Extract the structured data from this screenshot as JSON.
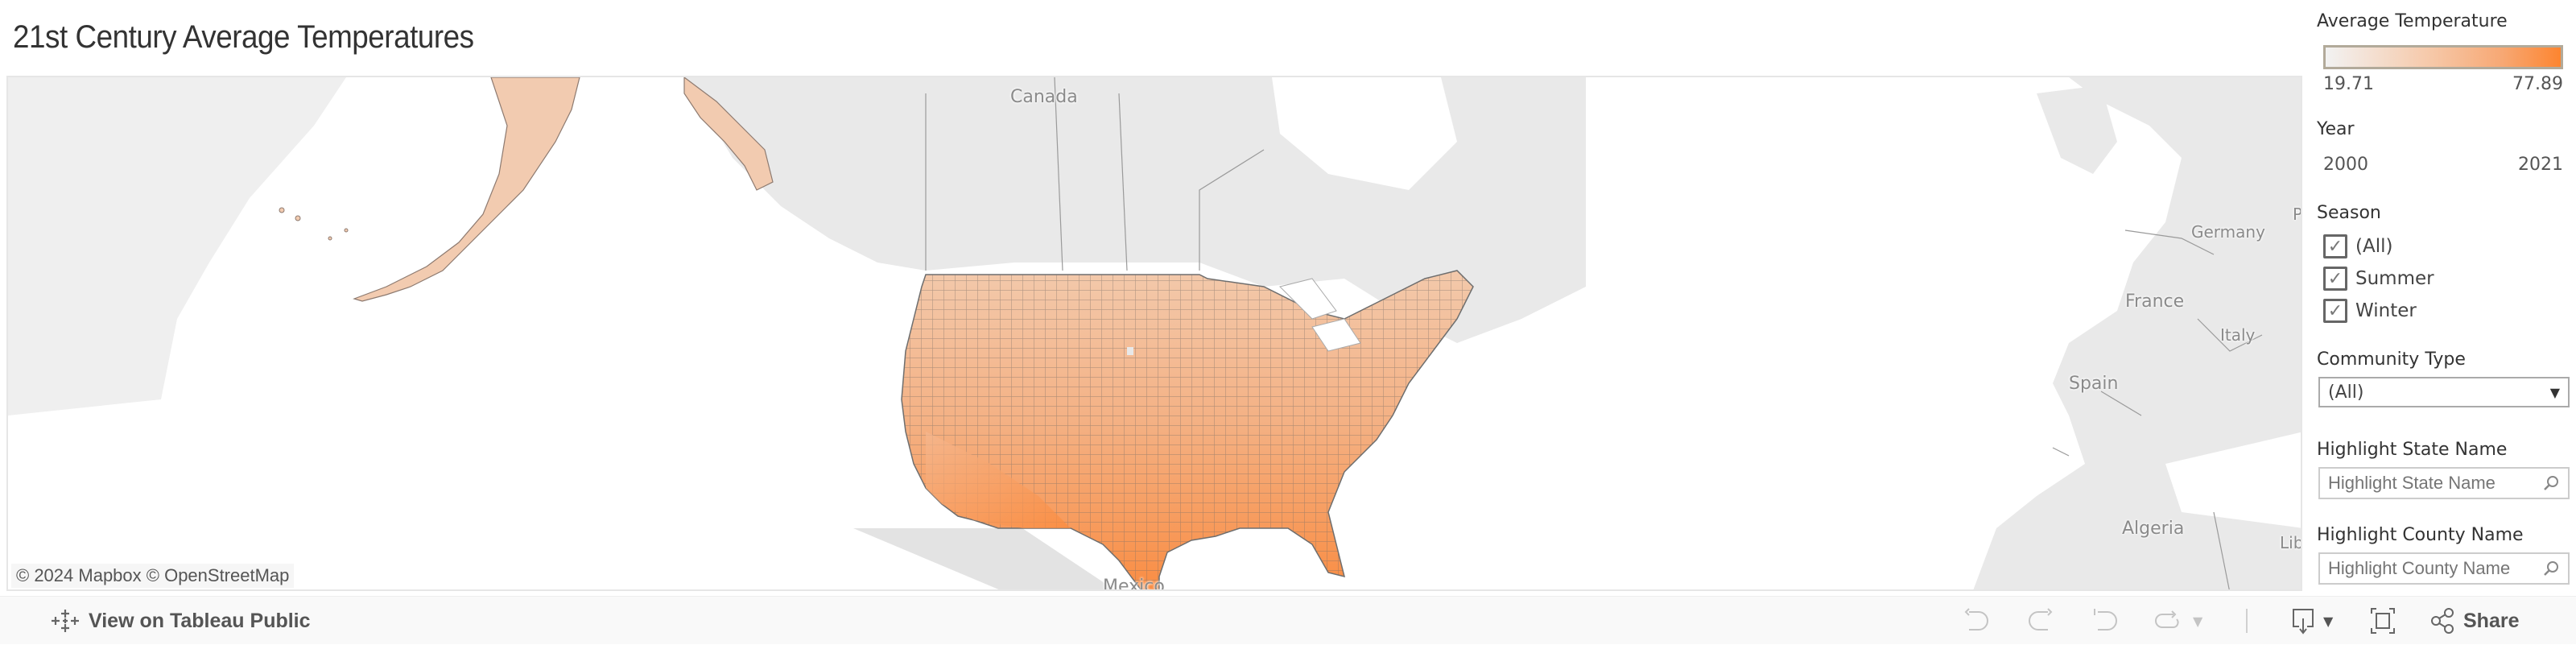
{
  "title": "21st Century  Average Temperatures",
  "map": {
    "labels": {
      "canada": "Canada",
      "mexico": "Mexico",
      "germany": "Germany",
      "france": "France",
      "italy": "Italy",
      "spain": "Spain",
      "algeria": "Algeria",
      "libya_partial": "Lib",
      "poland_partial": "P"
    },
    "attribution": "© 2024 Mapbox  © OpenStreetMap",
    "colors": {
      "low": "#f2f2f2",
      "mid": "#f6c8a8",
      "high": "#fd8530",
      "border": "#6e6e6e",
      "land": "#e8e8e8",
      "water": "#ffffff"
    }
  },
  "filters": {
    "average_temperature": {
      "title": "Average Temperature",
      "min": "19.71",
      "max": "77.89"
    },
    "year": {
      "title": "Year",
      "min": "2000",
      "max": "2021"
    },
    "season": {
      "title": "Season",
      "options": [
        {
          "label": "(All)",
          "checked": true
        },
        {
          "label": "Summer",
          "checked": true
        },
        {
          "label": "Winter",
          "checked": true
        }
      ]
    },
    "community_type": {
      "title": "Community Type",
      "selected": "(All)"
    },
    "highlight_state": {
      "title": "Highlight State Name",
      "placeholder": "Highlight State Name"
    },
    "highlight_county": {
      "title": "Highlight County Name",
      "placeholder": "Highlight County Name"
    }
  },
  "toolbar": {
    "view_on_public": "View on Tableau Public",
    "share": "Share"
  }
}
